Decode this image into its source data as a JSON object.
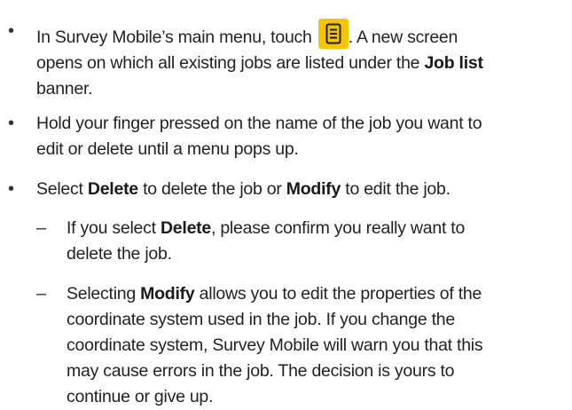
{
  "instructions": [
    {
      "level": 1,
      "marker": "•",
      "lines": [
        [
          "In Survey Mobile’s main menu, touch ",
          {
            "icon": "job-list-icon"
          },
          ". A new screen"
        ],
        [
          "opens on which all existing jobs are listed under the ",
          {
            "b": "Job list"
          }
        ],
        [
          "banner."
        ]
      ]
    },
    {
      "level": 1,
      "marker": "•",
      "lines": [
        [
          "Hold your finger pressed on the name of the job you want to"
        ],
        [
          "edit or delete until a menu pops up."
        ]
      ]
    },
    {
      "level": 1,
      "marker": "•",
      "lines": [
        [
          "Select ",
          {
            "b": "Delete"
          },
          " to delete the job or ",
          {
            "b": "Modify"
          },
          " to edit the job."
        ]
      ]
    },
    {
      "level": 2,
      "marker": "–",
      "lines": [
        [
          "If you select ",
          {
            "b": "Delete"
          },
          ", please confirm you really want to"
        ],
        [
          "delete the job."
        ]
      ]
    },
    {
      "level": 2,
      "marker": "–",
      "lines": [
        [
          "Selecting ",
          {
            "b": "Modify"
          },
          " allows you to edit the properties of the"
        ],
        [
          "coordinate system used in the job. If you change the"
        ],
        [
          "coordinate system, Survey Mobile will warn you that this"
        ],
        [
          "may cause errors in the job. The decision is yours to"
        ],
        [
          "continue or give up."
        ]
      ]
    }
  ],
  "colors": {
    "icon_background": "#f6c500",
    "icon_foreground": "#1a1a1a",
    "text": "#222222"
  }
}
